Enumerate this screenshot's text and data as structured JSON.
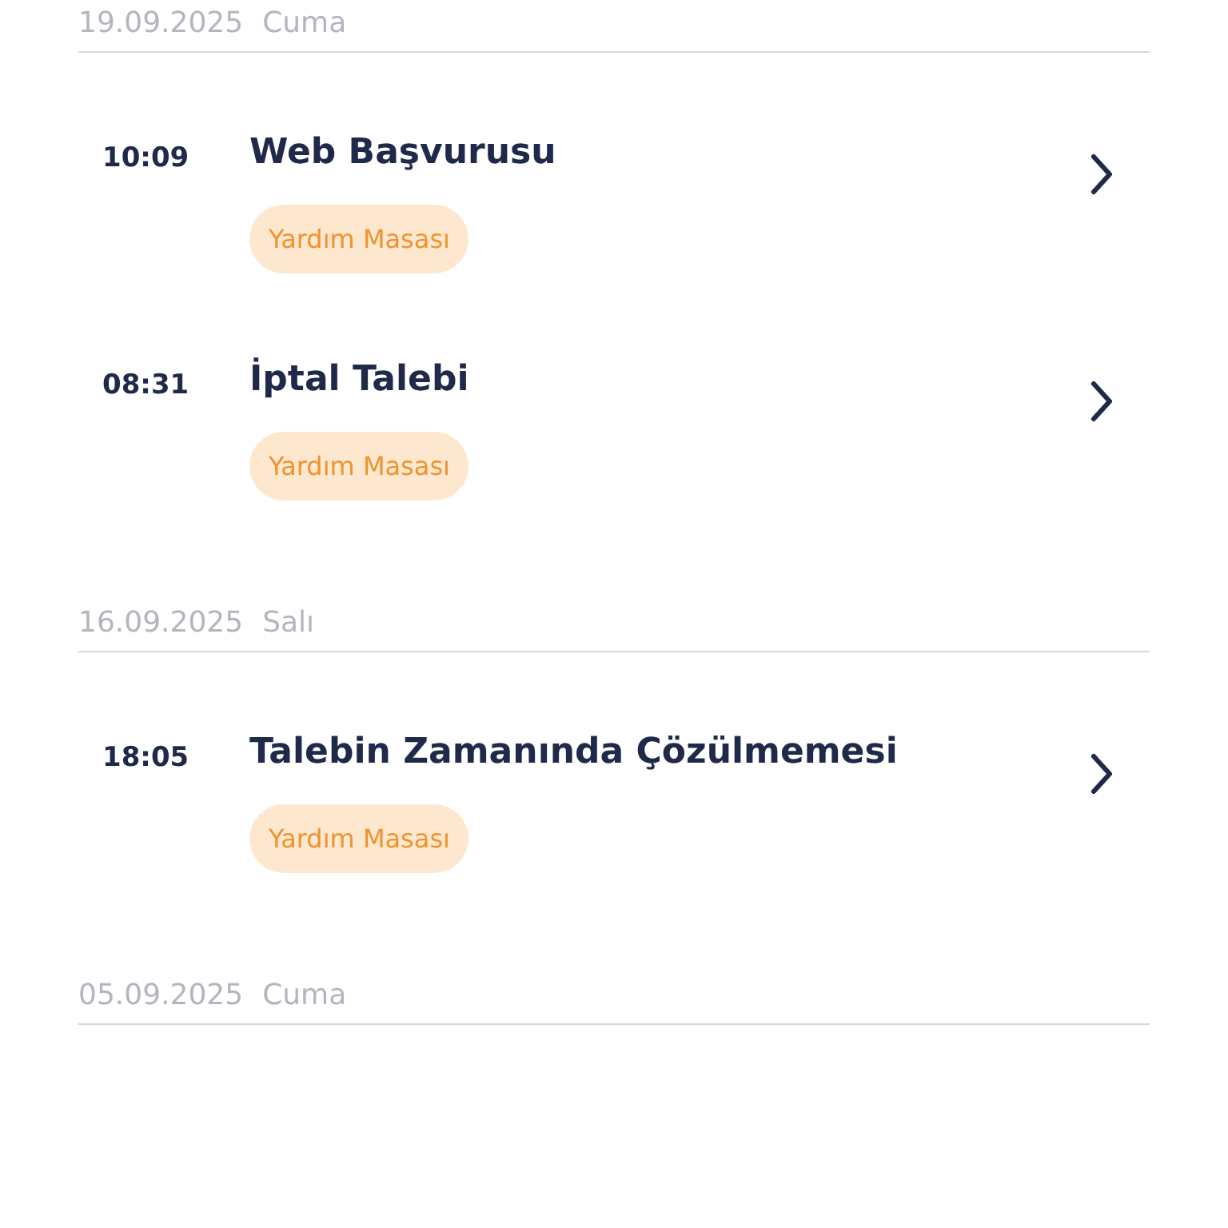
{
  "groups": [
    {
      "date": "19.09.2025",
      "day": "Cuma",
      "entries": [
        {
          "time": "10:09",
          "title": "Web Başvurusu",
          "tag": "Yardım Masası"
        },
        {
          "time": "08:31",
          "title": "İptal Talebi",
          "tag": "Yardım Masası"
        }
      ]
    },
    {
      "date": "16.09.2025",
      "day": "Salı",
      "entries": [
        {
          "time": "18:05",
          "title": "Talebin Zamanında Çözülmemesi",
          "tag": "Yardım Masası"
        }
      ]
    },
    {
      "date": "05.09.2025",
      "day": "Cuma"
    }
  ]
}
